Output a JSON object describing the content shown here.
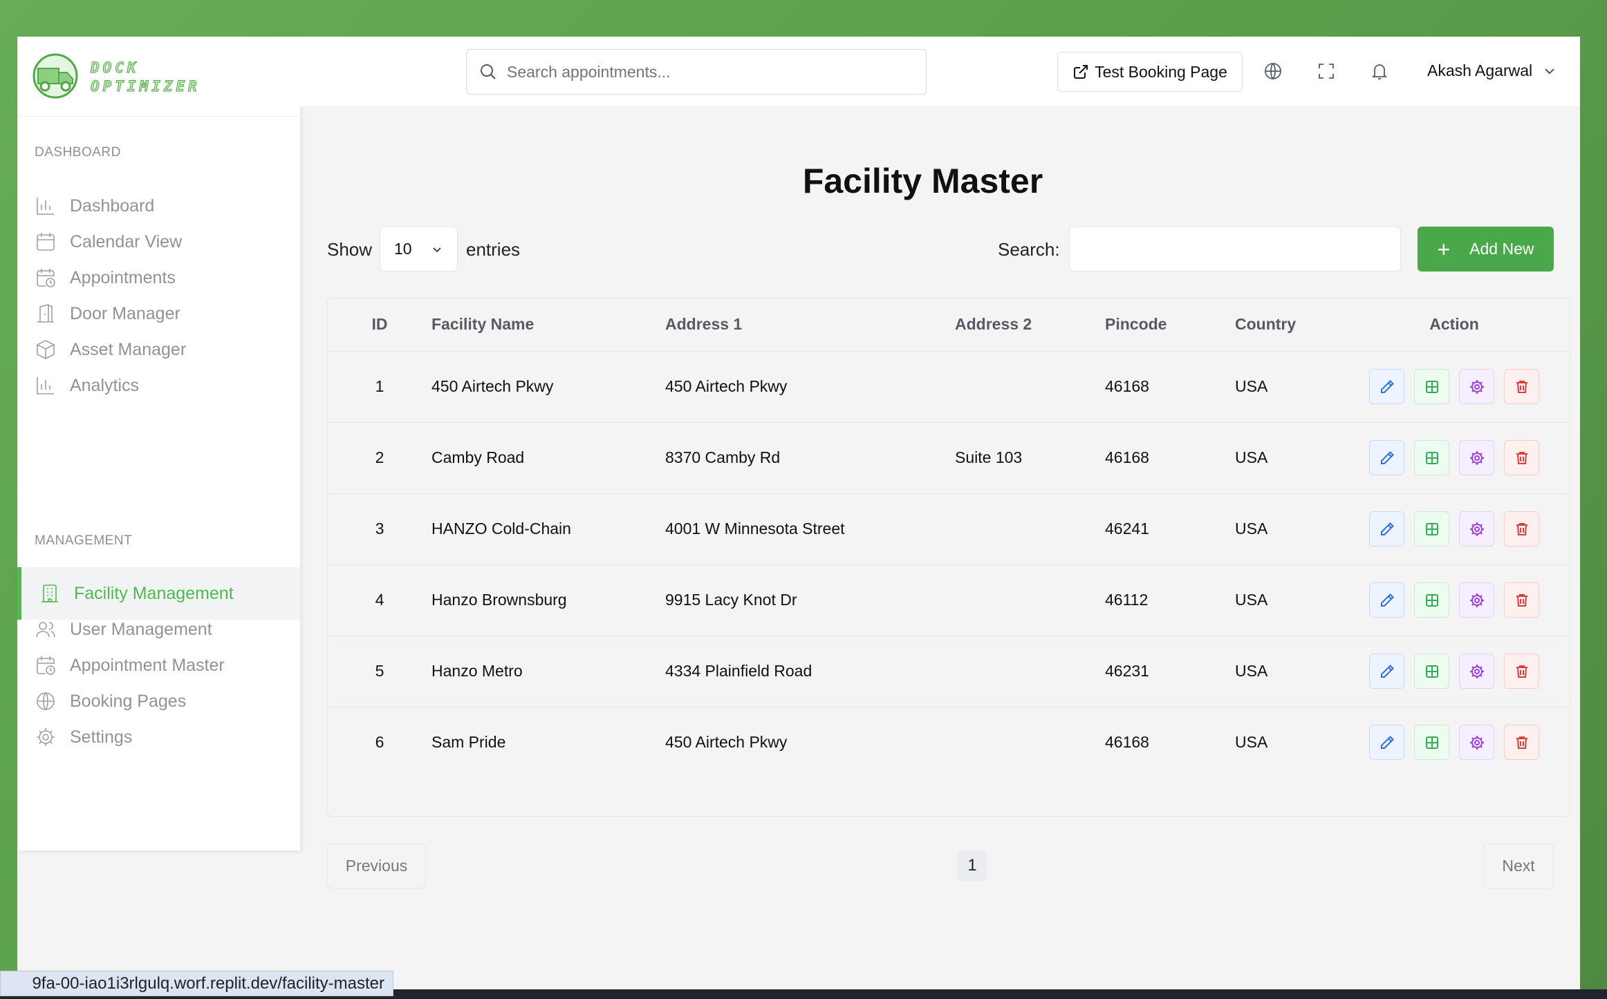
{
  "brand": {
    "line1": "DOCK",
    "line2": "OPTIMIZER"
  },
  "sidebar": {
    "section_dashboard": "DASHBOARD",
    "section_management": "MANAGEMENT",
    "items": [
      {
        "label": "Dashboard",
        "icon": "bar-chart-icon"
      },
      {
        "label": "Calendar View",
        "icon": "calendar-icon"
      },
      {
        "label": "Appointments",
        "icon": "calendar-clock-icon"
      },
      {
        "label": "Door Manager",
        "icon": "door-icon"
      },
      {
        "label": "Asset Manager",
        "icon": "box-icon"
      },
      {
        "label": "Analytics",
        "icon": "bar-chart-icon"
      },
      {
        "label": "Facility Management",
        "icon": "building-icon",
        "active": true
      },
      {
        "label": "User Management",
        "icon": "users-icon"
      },
      {
        "label": "Appointment Master",
        "icon": "calendar-clock-icon"
      },
      {
        "label": "Booking Pages",
        "icon": "globe-icon"
      },
      {
        "label": "Settings",
        "icon": "gear-icon"
      }
    ]
  },
  "topbar": {
    "search_placeholder": "Search appointments...",
    "test_booking_label": "Test Booking Page",
    "user_name": "Akash Agarwal"
  },
  "main": {
    "title": "Facility Master",
    "show_label": "Show",
    "entries_value": "10",
    "entries_label": "entries",
    "search_label": "Search:",
    "add_label": "Add New",
    "previous_label": "Previous",
    "next_label": "Next",
    "current_page": "1"
  },
  "table": {
    "headers": [
      "ID",
      "Facility Name",
      "Address 1",
      "Address 2",
      "Pincode",
      "Country",
      "Action"
    ],
    "rows": [
      [
        "1",
        "450 Airtech Pkwy",
        "450 Airtech Pkwy",
        "",
        "46168",
        "USA"
      ],
      [
        "2",
        "Camby Road",
        "8370 Camby Rd",
        "Suite 103",
        "46168",
        "USA"
      ],
      [
        "3",
        "HANZO Cold-Chain",
        "4001 W Minnesota Street",
        "",
        "46241",
        "USA"
      ],
      [
        "4",
        "Hanzo Brownsburg",
        "9915 Lacy Knot Dr",
        "",
        "46112",
        "USA"
      ],
      [
        "5",
        "Hanzo Metro",
        "4334 Plainfield Road",
        "",
        "46231",
        "USA"
      ],
      [
        "6",
        "Sam Pride",
        "450 Airtech Pkwy",
        "",
        "46168",
        "USA"
      ]
    ]
  },
  "status_url": "9fa-00-iao1i3rlgulq.worf.replit.dev/facility-master",
  "colors": {
    "accent": "#4fba4b",
    "add_button": "#4aa84a",
    "edit": "#2f6fe0",
    "grid": "#2fae55",
    "settings": "#9b3fe0",
    "delete": "#e03b3b"
  }
}
